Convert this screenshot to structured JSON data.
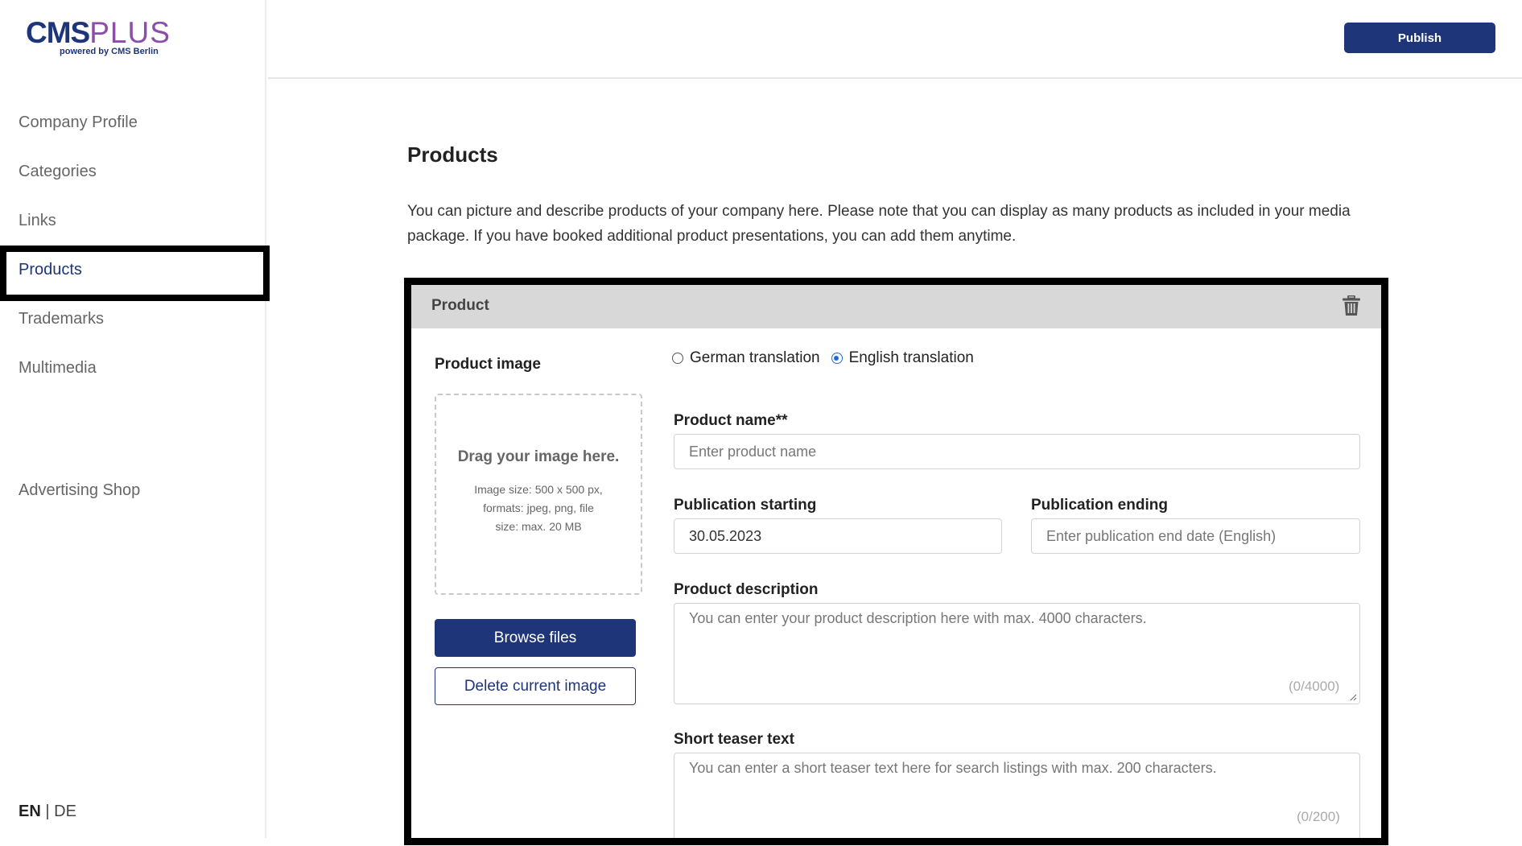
{
  "brand": {
    "logo_main_a": "CMS",
    "logo_main_b": "PLUS",
    "logo_sub": "powered by CMS Berlin"
  },
  "sidebar": {
    "items": [
      {
        "label": "Company Profile"
      },
      {
        "label": "Categories"
      },
      {
        "label": "Links"
      },
      {
        "label": "Products"
      },
      {
        "label": "Trademarks"
      },
      {
        "label": "Multimedia"
      }
    ],
    "shop_label": "Advertising Shop",
    "lang_active": "EN",
    "lang_sep": "|",
    "lang_other": "DE"
  },
  "header": {
    "publish_label": "Publish"
  },
  "main": {
    "title": "Products",
    "intro": "You can picture and describe products of your company here. Please note that you can display as many products as included in your media package. If you have booked additional product presentations, you can add them anytime."
  },
  "product_card": {
    "title": "Product",
    "image_label": "Product image",
    "drop_title": "Drag your image here.",
    "drop_info": "Image size: 500 x 500 px, formats: jpeg, png, file size: max. 20 MB",
    "browse_label": "Browse files",
    "delete_label": "Delete current image",
    "translation_options": [
      {
        "label": "German translation",
        "selected": false
      },
      {
        "label": "English translation",
        "selected": true
      }
    ],
    "name_label": "Product name**",
    "name_placeholder": "Enter product name",
    "pub_start_label": "Publication starting",
    "pub_start_value": "30.05.2023",
    "pub_end_label": "Publication ending",
    "pub_end_placeholder": "Enter publication end date (English)",
    "desc_label": "Product description",
    "desc_placeholder": "You can enter your product description here with max. 4000 characters.",
    "desc_counter": "(0/4000)",
    "teaser_label": "Short teaser text",
    "teaser_placeholder": "You can enter a short teaser text here for search listings with max. 200 characters.",
    "teaser_counter": "(0/200)"
  },
  "colors": {
    "brand_blue": "#1e3579",
    "brand_purple": "#8a4ea8",
    "radio_blue": "#1a6dd8"
  },
  "icons": {
    "trash": "trash-icon"
  }
}
